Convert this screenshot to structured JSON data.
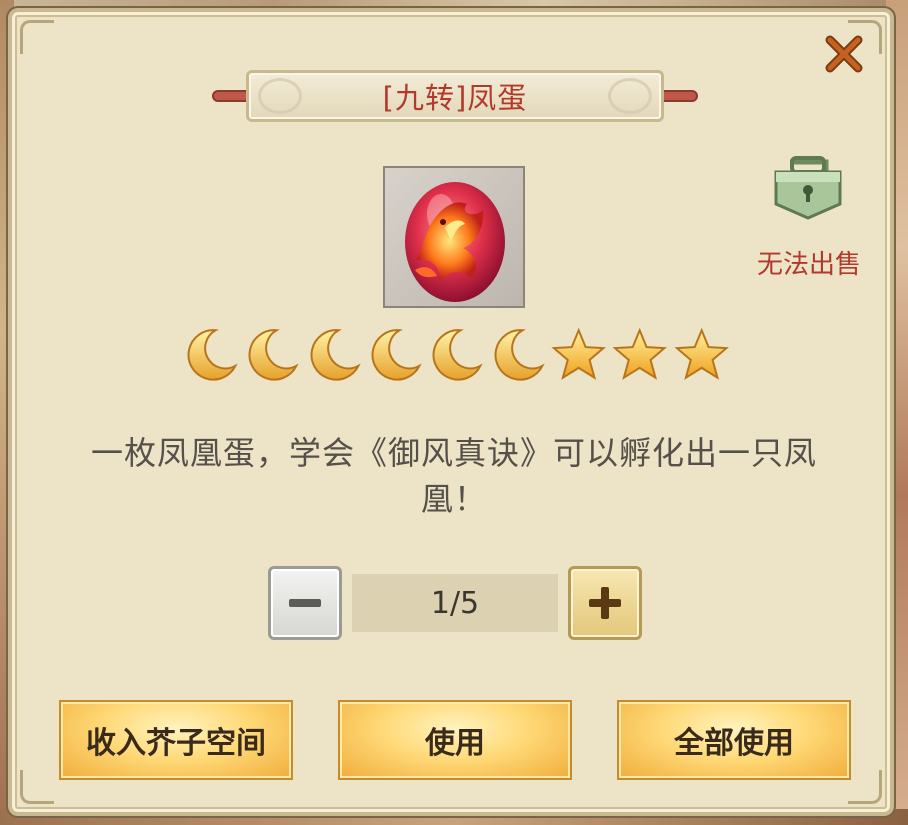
{
  "dialog": {
    "title": "[九转]凤蛋",
    "item_icon": "phoenix-egg-icon",
    "cannot_sell_label": "无法出售",
    "rating": {
      "moons": 6,
      "stars": 3
    },
    "description": "一枚凤凰蛋，学会《御风真诀》可以孵化出一只凤凰！",
    "quantity": {
      "value": "1/5",
      "current": 1,
      "max": 5
    },
    "buttons": {
      "store_label": "收入芥子空间",
      "use_label": "使用",
      "use_all_label": "全部使用"
    }
  },
  "colors": {
    "title_red": "#b23a2c",
    "panel_bg": "#ede3c6",
    "button_gold": "#ffd977",
    "sell_text": "#b03a2c"
  }
}
